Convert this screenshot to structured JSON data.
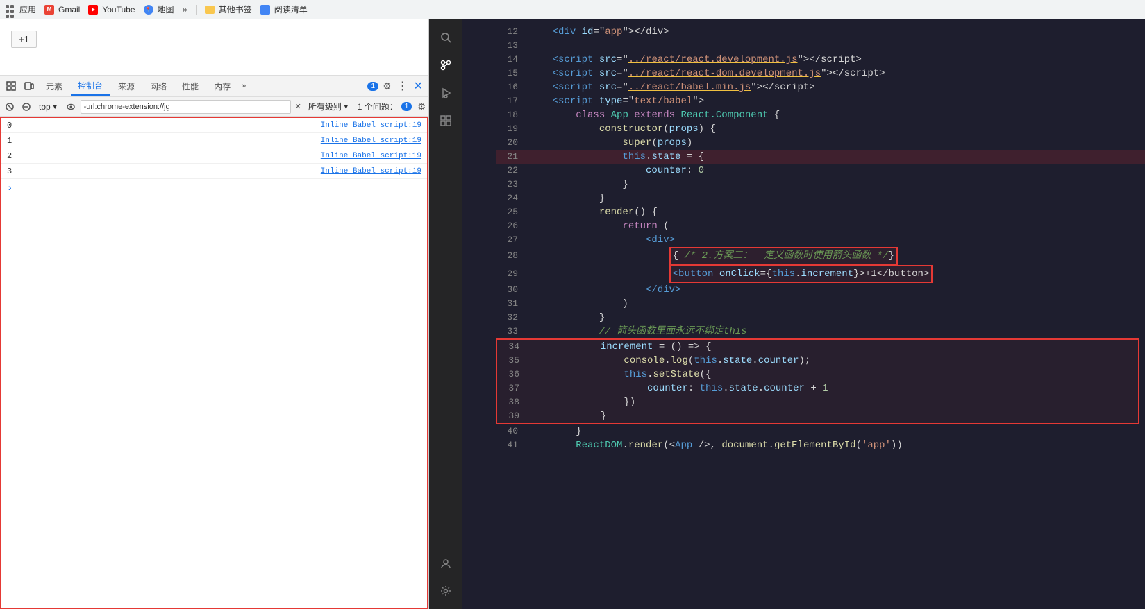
{
  "browser": {
    "apps_label": "应用",
    "gmail_label": "Gmail",
    "youtube_label": "YouTube",
    "maps_label": "地图",
    "more_tabs": "»",
    "other_bookmarks": "其他书签",
    "reading_list": "阅读清单",
    "more_bookmarks": "»"
  },
  "page": {
    "plus_one_button": "+1"
  },
  "devtools": {
    "tabs": [
      {
        "label": "元素",
        "active": false
      },
      {
        "label": "控制台",
        "active": true
      },
      {
        "label": "来源",
        "active": false
      },
      {
        "label": "网络",
        "active": false
      },
      {
        "label": "性能",
        "active": false
      },
      {
        "label": "内存",
        "active": false
      }
    ],
    "more_tabs": "»",
    "badge_count": "1",
    "filter_bar": {
      "top_label": "top",
      "search_placeholder": "-url:chrome-extension://jg",
      "level_label": "所有级别",
      "issues_label": "1 个问题：",
      "issues_count": "1"
    },
    "console_rows": [
      {
        "value": "0",
        "source": "Inline Babel script:19"
      },
      {
        "value": "1",
        "source": "Inline Babel script:19"
      },
      {
        "value": "2",
        "source": "Inline Babel script:19"
      },
      {
        "value": "3",
        "source": "Inline Babel script:19"
      }
    ],
    "prompt_char": ">"
  },
  "code": {
    "lines": [
      {
        "num": "12",
        "content": "    <div id=\"app\"></div>"
      },
      {
        "num": "13",
        "content": ""
      },
      {
        "num": "14",
        "content": "    <script src=\"../react/react.development.js\"><\\/script>"
      },
      {
        "num": "15",
        "content": "    <script src=\"../react/react-dom.development.js\"><\\/script>"
      },
      {
        "num": "16",
        "content": "    <script src=\"../react/babel.min.js\"><\\/script>"
      },
      {
        "num": "17",
        "content": "    <script type=\"text/babel\">"
      },
      {
        "num": "18",
        "content": "        class App extends React.Component {"
      },
      {
        "num": "19",
        "content": "            constructor(props) {"
      },
      {
        "num": "20",
        "content": "                super(props)"
      },
      {
        "num": "21",
        "content": "                this.state = {"
      },
      {
        "num": "22",
        "content": "                    counter: 0"
      },
      {
        "num": "23",
        "content": "                }"
      },
      {
        "num": "24",
        "content": "            }"
      },
      {
        "num": "25",
        "content": "            render() {"
      },
      {
        "num": "26",
        "content": "                return ("
      },
      {
        "num": "27",
        "content": "                    <div>"
      },
      {
        "num": "28",
        "content": "                        { /* 2.方案二：  定义函数时使用箭头函数 */}"
      },
      {
        "num": "29",
        "content": "                        <button onClick={this.increment}>+1</button>"
      },
      {
        "num": "30",
        "content": "                    </div>"
      },
      {
        "num": "31",
        "content": "                )"
      },
      {
        "num": "32",
        "content": "            }"
      },
      {
        "num": "33",
        "content": "            // 箭头函数里面永远不绑定this"
      },
      {
        "num": "34",
        "content": "            increment = () => {"
      },
      {
        "num": "35",
        "content": "                console.log(this.state.counter);"
      },
      {
        "num": "36",
        "content": "                this.setState({"
      },
      {
        "num": "37",
        "content": "                    counter: this.state.counter + 1"
      },
      {
        "num": "38",
        "content": "                })"
      },
      {
        "num": "39",
        "content": "            }"
      },
      {
        "num": "40",
        "content": "        }"
      },
      {
        "num": "41",
        "content": "        ReactDOM.render(<App />, document.getElementById('app'))"
      }
    ]
  }
}
